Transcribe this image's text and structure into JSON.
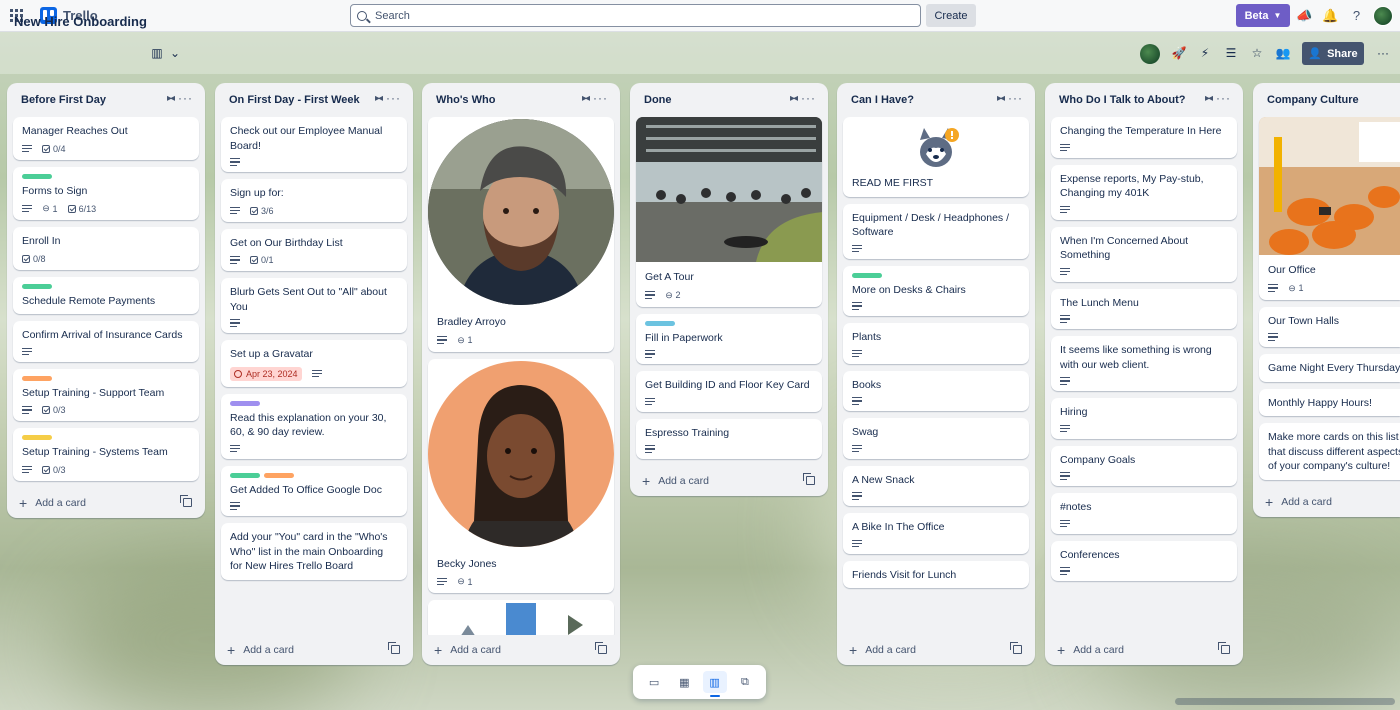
{
  "app": {
    "name": "Trello"
  },
  "search": {
    "placeholder": "Search"
  },
  "topbar": {
    "create_label": "Create",
    "beta_label": "Beta"
  },
  "board": {
    "title": "Board",
    "name": "New Hire Onboarding",
    "share_label": "Share"
  },
  "add_card_label": "Add a card",
  "lists": [
    {
      "title": "Before First Day",
      "cards": [
        {
          "title": "Manager Reaches Out",
          "desc": true,
          "checklist": "0/4"
        },
        {
          "title": "Forms to Sign",
          "labels": [
            "#4bce97"
          ],
          "desc": true,
          "attachments": "1",
          "checklist": "6/13"
        },
        {
          "title": "Enroll In",
          "checklist": "0/8"
        },
        {
          "title": "Schedule Remote Payments",
          "labels": [
            "#4bce97"
          ]
        },
        {
          "title": "Confirm Arrival of Insurance Cards",
          "desc": true
        },
        {
          "title": "Setup Training - Support Team",
          "labels": [
            "#fea362"
          ],
          "desc": true,
          "checklist": "0/3"
        },
        {
          "title": "Setup Training - Systems Team",
          "labels": [
            "#f5cd47"
          ],
          "desc": true,
          "checklist": "0/3"
        }
      ]
    },
    {
      "title": "On First Day - First Week",
      "cards": [
        {
          "title": "Check out our Employee Manual Board!",
          "desc": true
        },
        {
          "title": "Sign up for:",
          "desc": true,
          "checklist": "3/6"
        },
        {
          "title": "Get on Our Birthday List",
          "desc": true,
          "checklist": "0/1"
        },
        {
          "title": "Blurb Gets Sent Out to \"All\" about You",
          "desc": true
        },
        {
          "title": "Set up a Gravatar",
          "due": "Apr 23, 2024",
          "desc": true
        },
        {
          "title": "Read this explanation on your 30, 60, & 90 day review.",
          "labels": [
            "#9f8fef"
          ],
          "desc": true
        },
        {
          "title": "Get Added To Office Google Doc",
          "labels": [
            "#4bce97",
            "#fea362"
          ],
          "desc": true
        },
        {
          "title": "Add your \"You\" card in the \"Who's Who\" list in the main Onboarding for New Hires Trello Board"
        }
      ]
    },
    {
      "title": "Who's Who",
      "cards": [
        {
          "title": "Bradley Arroyo",
          "desc": true,
          "attachments": "1"
        },
        {
          "title": "Becky Jones",
          "desc": true,
          "attachments": "1"
        }
      ]
    },
    {
      "title": "Done",
      "cards": [
        {
          "title": "Get A Tour",
          "desc": true,
          "attachments": "2"
        },
        {
          "title": "Fill in Paperwork",
          "labels": [
            "#6cc3e0"
          ],
          "desc": true
        },
        {
          "title": "Get Building ID and Floor Key Card",
          "desc": true
        },
        {
          "title": "Espresso Training",
          "desc": true
        }
      ]
    },
    {
      "title": "Can I Have?",
      "cards": [
        {
          "title": "READ ME FIRST"
        },
        {
          "title": "Equipment / Desk / Headphones / Software",
          "desc": true
        },
        {
          "title": "More on Desks & Chairs",
          "labels": [
            "#4bce97"
          ],
          "desc": true
        },
        {
          "title": "Plants",
          "desc": true
        },
        {
          "title": "Books",
          "desc": true
        },
        {
          "title": "Swag",
          "desc": true
        },
        {
          "title": "A New Snack",
          "desc": true
        },
        {
          "title": "A Bike In The Office",
          "desc": true
        },
        {
          "title": "Friends Visit for Lunch"
        }
      ]
    },
    {
      "title": "Who Do I Talk to About?",
      "cards": [
        {
          "title": "Changing the Temperature In Here",
          "desc": true
        },
        {
          "title": "Expense reports, My Pay-stub, Changing my 401K",
          "desc": true
        },
        {
          "title": "When I'm Concerned About Something",
          "desc": true
        },
        {
          "title": "The Lunch Menu",
          "desc": true
        },
        {
          "title": "It seems like something is wrong with our web client.",
          "desc": true
        },
        {
          "title": "Hiring",
          "desc": true
        },
        {
          "title": "Company Goals",
          "desc": true
        },
        {
          "title": "#notes",
          "desc": true
        },
        {
          "title": "Conferences",
          "desc": true
        }
      ]
    },
    {
      "title": "Company Culture",
      "cards": [
        {
          "title": "Our Office",
          "desc": true,
          "attachments": "1"
        },
        {
          "title": "Our Town Halls",
          "desc": true
        },
        {
          "title": "Game Night Every Thursday"
        },
        {
          "title": "Monthly Happy Hours!"
        },
        {
          "title": "Make more cards on this list that discuss different aspects of your company's culture!"
        }
      ]
    }
  ]
}
